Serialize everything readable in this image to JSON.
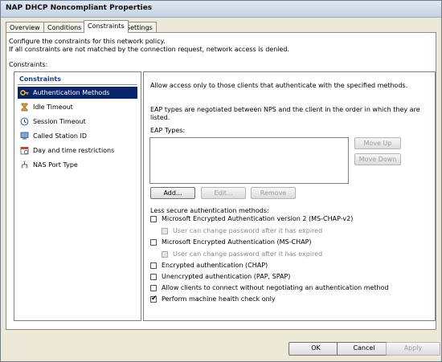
{
  "window": {
    "title": "NAP DHCP Noncompliant Properties"
  },
  "tabs": [
    {
      "label": "Overview"
    },
    {
      "label": "Conditions"
    },
    {
      "label": "Constraints"
    },
    {
      "label": "Settings"
    }
  ],
  "description": {
    "line1": "Configure the constraints for this network policy.",
    "line2": "If all constraints are not matched by the connection request, network access is denied."
  },
  "constraints_label": "Constraints:",
  "left_panel": {
    "header": "Constraints",
    "items": [
      {
        "label": "Authentication Methods",
        "icon": "key-icon"
      },
      {
        "label": "Idle Timeout",
        "icon": "hourglass-icon"
      },
      {
        "label": "Session Timeout",
        "icon": "clock-icon"
      },
      {
        "label": "Called Station ID",
        "icon": "computer-icon"
      },
      {
        "label": "Day and time restrictions",
        "icon": "calendar-icon"
      },
      {
        "label": "NAS Port Type",
        "icon": "network-port-icon"
      }
    ]
  },
  "right_panel": {
    "intro": "Allow access only to those clients that authenticate with the specified methods.",
    "eap_note_line1": "EAP types are negotiated between NPS and the client in the order in which they are",
    "eap_note_line2": "listed.",
    "eap_types_label": "EAP Types:",
    "move_up": "Move Up",
    "move_down": "Move Down",
    "add": "Add...",
    "edit": "Edit...",
    "remove": "Remove",
    "less_secure_label": "Less secure authentication methods:",
    "checks": [
      {
        "label": "Microsoft Encrypted Authentication version 2 (MS-CHAP-v2)",
        "checked": false,
        "enabled": true
      },
      {
        "label": "User can change password after it has expired",
        "checked": false,
        "enabled": false
      },
      {
        "label": "Microsoft Encrypted Authentication (MS-CHAP)",
        "checked": false,
        "enabled": true
      },
      {
        "label": "User can change password after it has expired",
        "checked": false,
        "enabled": false
      },
      {
        "label": "Encrypted authentication (CHAP)",
        "checked": false,
        "enabled": true
      },
      {
        "label": "Unencrypted authentication (PAP, SPAP)",
        "checked": false,
        "enabled": true
      },
      {
        "label": "Allow clients to connect without negotiating an authentication method",
        "checked": false,
        "enabled": true
      },
      {
        "label": "Perform machine health check only",
        "checked": true,
        "enabled": true
      }
    ],
    "checkmark": "✔"
  },
  "footer": {
    "ok": "OK",
    "cancel": "Cancel",
    "apply": "Apply"
  }
}
